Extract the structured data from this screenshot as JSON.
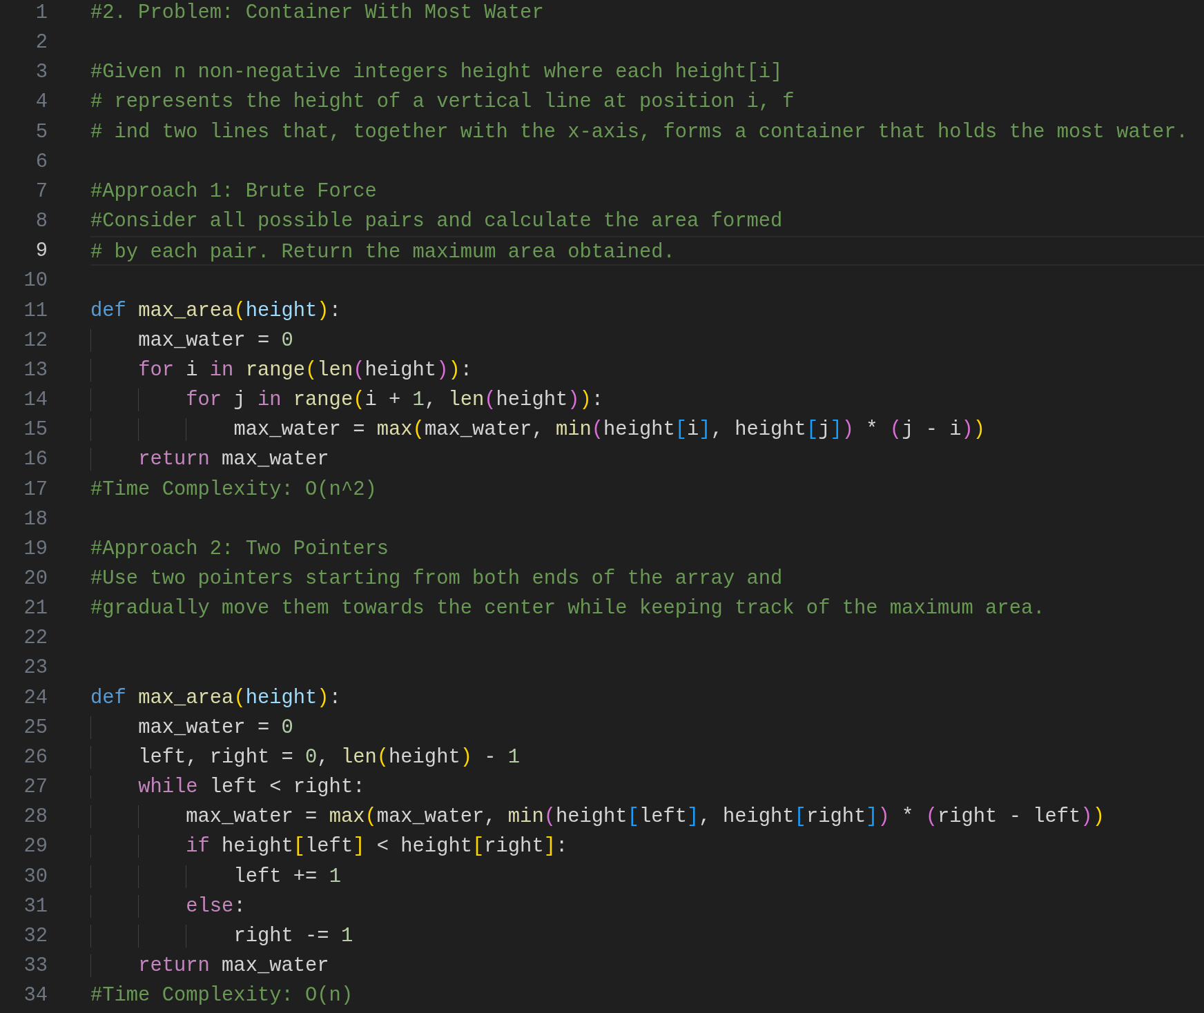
{
  "lines": [
    {
      "number": "1",
      "selected": false,
      "tokens": [
        {
          "kind": "comment",
          "text": "#2. Problem: Container With Most Water"
        }
      ]
    },
    {
      "number": "2",
      "selected": false
    },
    {
      "number": "3",
      "selected": false,
      "tokens": [
        {
          "kind": "comment",
          "text": "#Given n non-negative integers height where each height[i]"
        }
      ]
    },
    {
      "number": "4",
      "selected": false,
      "tokens": [
        {
          "kind": "comment",
          "text": "# represents the height of a vertical line at position i, f"
        }
      ]
    },
    {
      "number": "5",
      "selected": false,
      "tokens": [
        {
          "kind": "comment",
          "text": "# ind two lines that, together with the x-axis, forms a container that holds the most water."
        }
      ]
    },
    {
      "number": "6",
      "selected": false
    },
    {
      "number": "7",
      "selected": false,
      "tokens": [
        {
          "kind": "comment",
          "text": "#Approach 1: Brute Force"
        }
      ]
    },
    {
      "number": "8",
      "selected": false,
      "tokens": [
        {
          "kind": "comment",
          "text": "#Consider all possible pairs and calculate the area formed"
        }
      ]
    },
    {
      "number": "9",
      "selected": true,
      "tokens": [
        {
          "kind": "comment",
          "text": "# by each pair. Return the maximum area obtained."
        }
      ]
    },
    {
      "number": "10",
      "selected": false
    },
    {
      "number": "11",
      "selected": false,
      "tokens": [
        {
          "kind": "keyword",
          "text": "def "
        },
        {
          "kind": "function",
          "text": "max_area"
        },
        {
          "kind": "bracket1",
          "text": "("
        },
        {
          "kind": "param",
          "text": "height"
        },
        {
          "kind": "bracket1",
          "text": ")"
        },
        {
          "kind": "plain",
          "text": ":"
        }
      ]
    },
    {
      "number": "12",
      "selected": false,
      "tokens": [
        {
          "kind": "plain",
          "text": "    max_water = "
        },
        {
          "kind": "number",
          "text": "0"
        }
      ]
    },
    {
      "number": "13",
      "selected": false,
      "tokens": [
        {
          "kind": "control",
          "text": "    for"
        },
        {
          "kind": "plain",
          "text": " i "
        },
        {
          "kind": "control",
          "text": "in "
        },
        {
          "kind": "function",
          "text": "range"
        },
        {
          "kind": "bracket1",
          "text": "("
        },
        {
          "kind": "function",
          "text": "len"
        },
        {
          "kind": "bracket2",
          "text": "("
        },
        {
          "kind": "plain",
          "text": "height"
        },
        {
          "kind": "bracket2",
          "text": ")"
        },
        {
          "kind": "bracket1",
          "text": ")"
        },
        {
          "kind": "plain",
          "text": ":"
        }
      ]
    },
    {
      "number": "14",
      "selected": false,
      "tokens": [
        {
          "kind": "control",
          "text": "        for"
        },
        {
          "kind": "plain",
          "text": " j "
        },
        {
          "kind": "control",
          "text": "in "
        },
        {
          "kind": "function",
          "text": "range"
        },
        {
          "kind": "bracket1",
          "text": "("
        },
        {
          "kind": "plain",
          "text": "i + "
        },
        {
          "kind": "number",
          "text": "1"
        },
        {
          "kind": "plain",
          "text": ", "
        },
        {
          "kind": "function",
          "text": "len"
        },
        {
          "kind": "bracket2",
          "text": "("
        },
        {
          "kind": "plain",
          "text": "height"
        },
        {
          "kind": "bracket2",
          "text": ")"
        },
        {
          "kind": "bracket1",
          "text": ")"
        },
        {
          "kind": "plain",
          "text": ":"
        }
      ]
    },
    {
      "number": "15",
      "selected": false,
      "tokens": [
        {
          "kind": "plain",
          "text": "            max_water = "
        },
        {
          "kind": "function",
          "text": "max"
        },
        {
          "kind": "bracket1",
          "text": "("
        },
        {
          "kind": "plain",
          "text": "max_water, "
        },
        {
          "kind": "function",
          "text": "min"
        },
        {
          "kind": "bracket2",
          "text": "("
        },
        {
          "kind": "plain",
          "text": "height"
        },
        {
          "kind": "bracket3",
          "text": "["
        },
        {
          "kind": "plain",
          "text": "i"
        },
        {
          "kind": "bracket3",
          "text": "]"
        },
        {
          "kind": "plain",
          "text": ", height"
        },
        {
          "kind": "bracket3",
          "text": "["
        },
        {
          "kind": "plain",
          "text": "j"
        },
        {
          "kind": "bracket3",
          "text": "]"
        },
        {
          "kind": "bracket2",
          "text": ")"
        },
        {
          "kind": "plain",
          "text": " * "
        },
        {
          "kind": "bracket2",
          "text": "("
        },
        {
          "kind": "plain",
          "text": "j - i"
        },
        {
          "kind": "bracket2",
          "text": ")"
        },
        {
          "kind": "bracket1",
          "text": ")"
        }
      ]
    },
    {
      "number": "16",
      "selected": false,
      "tokens": [
        {
          "kind": "control",
          "text": "    return"
        },
        {
          "kind": "plain",
          "text": " max_water"
        }
      ]
    },
    {
      "number": "17",
      "selected": false,
      "tokens": [
        {
          "kind": "comment",
          "text": "#Time Complexity: O(n^2)"
        }
      ]
    },
    {
      "number": "18",
      "selected": false
    },
    {
      "number": "19",
      "selected": false,
      "tokens": [
        {
          "kind": "comment",
          "text": "#Approach 2: Two Pointers"
        }
      ]
    },
    {
      "number": "20",
      "selected": false,
      "tokens": [
        {
          "kind": "comment",
          "text": "#Use two pointers starting from both ends of the array and"
        }
      ]
    },
    {
      "number": "21",
      "selected": false,
      "tokens": [
        {
          "kind": "comment",
          "text": "#gradually move them towards the center while keeping track of the maximum area."
        }
      ]
    },
    {
      "number": "22",
      "selected": false
    },
    {
      "number": "23",
      "selected": false
    },
    {
      "number": "24",
      "selected": false,
      "tokens": [
        {
          "kind": "keyword",
          "text": "def "
        },
        {
          "kind": "function",
          "text": "max_area"
        },
        {
          "kind": "bracket1",
          "text": "("
        },
        {
          "kind": "param",
          "text": "height"
        },
        {
          "kind": "bracket1",
          "text": ")"
        },
        {
          "kind": "plain",
          "text": ":"
        }
      ]
    },
    {
      "number": "25",
      "selected": false,
      "tokens": [
        {
          "kind": "plain",
          "text": "    max_water = "
        },
        {
          "kind": "number",
          "text": "0"
        }
      ]
    },
    {
      "number": "26",
      "selected": false,
      "tokens": [
        {
          "kind": "plain",
          "text": "    left, right = "
        },
        {
          "kind": "number",
          "text": "0"
        },
        {
          "kind": "plain",
          "text": ", "
        },
        {
          "kind": "function",
          "text": "len"
        },
        {
          "kind": "bracket1",
          "text": "("
        },
        {
          "kind": "plain",
          "text": "height"
        },
        {
          "kind": "bracket1",
          "text": ")"
        },
        {
          "kind": "plain",
          "text": " - "
        },
        {
          "kind": "number",
          "text": "1"
        }
      ]
    },
    {
      "number": "27",
      "selected": false,
      "tokens": [
        {
          "kind": "control",
          "text": "    while"
        },
        {
          "kind": "plain",
          "text": " left < right:"
        }
      ]
    },
    {
      "number": "28",
      "selected": false,
      "tokens": [
        {
          "kind": "plain",
          "text": "        max_water = "
        },
        {
          "kind": "function",
          "text": "max"
        },
        {
          "kind": "bracket1",
          "text": "("
        },
        {
          "kind": "plain",
          "text": "max_water, "
        },
        {
          "kind": "function",
          "text": "min"
        },
        {
          "kind": "bracket2",
          "text": "("
        },
        {
          "kind": "plain",
          "text": "height"
        },
        {
          "kind": "bracket3",
          "text": "["
        },
        {
          "kind": "plain",
          "text": "left"
        },
        {
          "kind": "bracket3",
          "text": "]"
        },
        {
          "kind": "plain",
          "text": ", height"
        },
        {
          "kind": "bracket3",
          "text": "["
        },
        {
          "kind": "plain",
          "text": "right"
        },
        {
          "kind": "bracket3",
          "text": "]"
        },
        {
          "kind": "bracket2",
          "text": ")"
        },
        {
          "kind": "plain",
          "text": " * "
        },
        {
          "kind": "bracket2",
          "text": "("
        },
        {
          "kind": "plain",
          "text": "right - left"
        },
        {
          "kind": "bracket2",
          "text": ")"
        },
        {
          "kind": "bracket1",
          "text": ")"
        }
      ]
    },
    {
      "number": "29",
      "selected": false,
      "tokens": [
        {
          "kind": "control",
          "text": "        if"
        },
        {
          "kind": "plain",
          "text": " height"
        },
        {
          "kind": "bracket1",
          "text": "["
        },
        {
          "kind": "plain",
          "text": "left"
        },
        {
          "kind": "bracket1",
          "text": "]"
        },
        {
          "kind": "plain",
          "text": " < height"
        },
        {
          "kind": "bracket1",
          "text": "["
        },
        {
          "kind": "plain",
          "text": "right"
        },
        {
          "kind": "bracket1",
          "text": "]"
        },
        {
          "kind": "plain",
          "text": ":"
        }
      ]
    },
    {
      "number": "30",
      "selected": false,
      "tokens": [
        {
          "kind": "plain",
          "text": "            left += "
        },
        {
          "kind": "number",
          "text": "1"
        }
      ]
    },
    {
      "number": "31",
      "selected": false,
      "tokens": [
        {
          "kind": "control",
          "text": "        else"
        },
        {
          "kind": "plain",
          "text": ":"
        }
      ]
    },
    {
      "number": "32",
      "selected": false,
      "tokens": [
        {
          "kind": "plain",
          "text": "            right -= "
        },
        {
          "kind": "number",
          "text": "1"
        }
      ]
    },
    {
      "number": "33",
      "selected": false,
      "tokens": [
        {
          "kind": "control",
          "text": "    return"
        },
        {
          "kind": "plain",
          "text": " max_water"
        }
      ]
    },
    {
      "number": "34",
      "selected": false,
      "tokens": [
        {
          "kind": "comment",
          "text": "#Time Complexity: O(n)"
        }
      ]
    }
  ]
}
